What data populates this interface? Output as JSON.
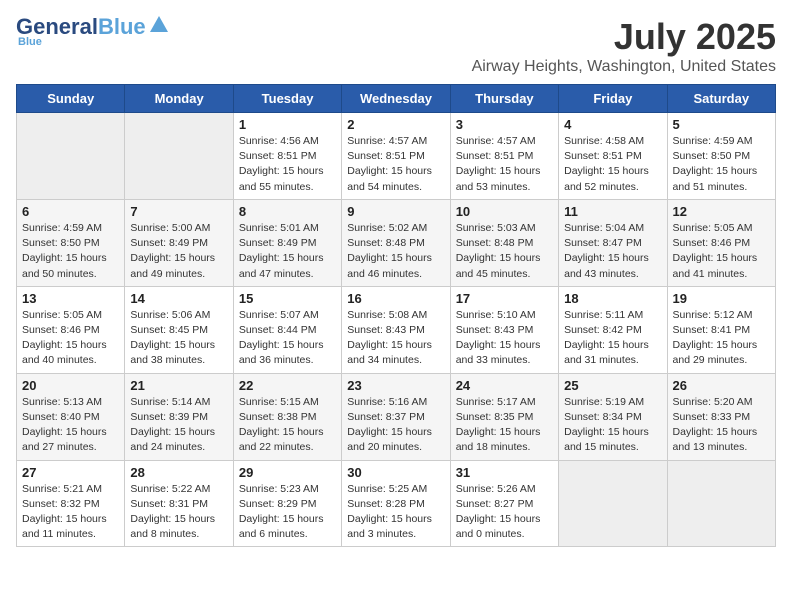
{
  "header": {
    "logo_line1": "General",
    "logo_line2": "Blue",
    "month": "July 2025",
    "location": "Airway Heights, Washington, United States"
  },
  "weekdays": [
    "Sunday",
    "Monday",
    "Tuesday",
    "Wednesday",
    "Thursday",
    "Friday",
    "Saturday"
  ],
  "weeks": [
    [
      {
        "day": "",
        "sunrise": "",
        "sunset": "",
        "daylight": "",
        "empty": true
      },
      {
        "day": "",
        "sunrise": "",
        "sunset": "",
        "daylight": "",
        "empty": true
      },
      {
        "day": "1",
        "sunrise": "Sunrise: 4:56 AM",
        "sunset": "Sunset: 8:51 PM",
        "daylight": "Daylight: 15 hours and 55 minutes."
      },
      {
        "day": "2",
        "sunrise": "Sunrise: 4:57 AM",
        "sunset": "Sunset: 8:51 PM",
        "daylight": "Daylight: 15 hours and 54 minutes."
      },
      {
        "day": "3",
        "sunrise": "Sunrise: 4:57 AM",
        "sunset": "Sunset: 8:51 PM",
        "daylight": "Daylight: 15 hours and 53 minutes."
      },
      {
        "day": "4",
        "sunrise": "Sunrise: 4:58 AM",
        "sunset": "Sunset: 8:51 PM",
        "daylight": "Daylight: 15 hours and 52 minutes."
      },
      {
        "day": "5",
        "sunrise": "Sunrise: 4:59 AM",
        "sunset": "Sunset: 8:50 PM",
        "daylight": "Daylight: 15 hours and 51 minutes."
      }
    ],
    [
      {
        "day": "6",
        "sunrise": "Sunrise: 4:59 AM",
        "sunset": "Sunset: 8:50 PM",
        "daylight": "Daylight: 15 hours and 50 minutes."
      },
      {
        "day": "7",
        "sunrise": "Sunrise: 5:00 AM",
        "sunset": "Sunset: 8:49 PM",
        "daylight": "Daylight: 15 hours and 49 minutes."
      },
      {
        "day": "8",
        "sunrise": "Sunrise: 5:01 AM",
        "sunset": "Sunset: 8:49 PM",
        "daylight": "Daylight: 15 hours and 47 minutes."
      },
      {
        "day": "9",
        "sunrise": "Sunrise: 5:02 AM",
        "sunset": "Sunset: 8:48 PM",
        "daylight": "Daylight: 15 hours and 46 minutes."
      },
      {
        "day": "10",
        "sunrise": "Sunrise: 5:03 AM",
        "sunset": "Sunset: 8:48 PM",
        "daylight": "Daylight: 15 hours and 45 minutes."
      },
      {
        "day": "11",
        "sunrise": "Sunrise: 5:04 AM",
        "sunset": "Sunset: 8:47 PM",
        "daylight": "Daylight: 15 hours and 43 minutes."
      },
      {
        "day": "12",
        "sunrise": "Sunrise: 5:05 AM",
        "sunset": "Sunset: 8:46 PM",
        "daylight": "Daylight: 15 hours and 41 minutes."
      }
    ],
    [
      {
        "day": "13",
        "sunrise": "Sunrise: 5:05 AM",
        "sunset": "Sunset: 8:46 PM",
        "daylight": "Daylight: 15 hours and 40 minutes."
      },
      {
        "day": "14",
        "sunrise": "Sunrise: 5:06 AM",
        "sunset": "Sunset: 8:45 PM",
        "daylight": "Daylight: 15 hours and 38 minutes."
      },
      {
        "day": "15",
        "sunrise": "Sunrise: 5:07 AM",
        "sunset": "Sunset: 8:44 PM",
        "daylight": "Daylight: 15 hours and 36 minutes."
      },
      {
        "day": "16",
        "sunrise": "Sunrise: 5:08 AM",
        "sunset": "Sunset: 8:43 PM",
        "daylight": "Daylight: 15 hours and 34 minutes."
      },
      {
        "day": "17",
        "sunrise": "Sunrise: 5:10 AM",
        "sunset": "Sunset: 8:43 PM",
        "daylight": "Daylight: 15 hours and 33 minutes."
      },
      {
        "day": "18",
        "sunrise": "Sunrise: 5:11 AM",
        "sunset": "Sunset: 8:42 PM",
        "daylight": "Daylight: 15 hours and 31 minutes."
      },
      {
        "day": "19",
        "sunrise": "Sunrise: 5:12 AM",
        "sunset": "Sunset: 8:41 PM",
        "daylight": "Daylight: 15 hours and 29 minutes."
      }
    ],
    [
      {
        "day": "20",
        "sunrise": "Sunrise: 5:13 AM",
        "sunset": "Sunset: 8:40 PM",
        "daylight": "Daylight: 15 hours and 27 minutes."
      },
      {
        "day": "21",
        "sunrise": "Sunrise: 5:14 AM",
        "sunset": "Sunset: 8:39 PM",
        "daylight": "Daylight: 15 hours and 24 minutes."
      },
      {
        "day": "22",
        "sunrise": "Sunrise: 5:15 AM",
        "sunset": "Sunset: 8:38 PM",
        "daylight": "Daylight: 15 hours and 22 minutes."
      },
      {
        "day": "23",
        "sunrise": "Sunrise: 5:16 AM",
        "sunset": "Sunset: 8:37 PM",
        "daylight": "Daylight: 15 hours and 20 minutes."
      },
      {
        "day": "24",
        "sunrise": "Sunrise: 5:17 AM",
        "sunset": "Sunset: 8:35 PM",
        "daylight": "Daylight: 15 hours and 18 minutes."
      },
      {
        "day": "25",
        "sunrise": "Sunrise: 5:19 AM",
        "sunset": "Sunset: 8:34 PM",
        "daylight": "Daylight: 15 hours and 15 minutes."
      },
      {
        "day": "26",
        "sunrise": "Sunrise: 5:20 AM",
        "sunset": "Sunset: 8:33 PM",
        "daylight": "Daylight: 15 hours and 13 minutes."
      }
    ],
    [
      {
        "day": "27",
        "sunrise": "Sunrise: 5:21 AM",
        "sunset": "Sunset: 8:32 PM",
        "daylight": "Daylight: 15 hours and 11 minutes."
      },
      {
        "day": "28",
        "sunrise": "Sunrise: 5:22 AM",
        "sunset": "Sunset: 8:31 PM",
        "daylight": "Daylight: 15 hours and 8 minutes."
      },
      {
        "day": "29",
        "sunrise": "Sunrise: 5:23 AM",
        "sunset": "Sunset: 8:29 PM",
        "daylight": "Daylight: 15 hours and 6 minutes."
      },
      {
        "day": "30",
        "sunrise": "Sunrise: 5:25 AM",
        "sunset": "Sunset: 8:28 PM",
        "daylight": "Daylight: 15 hours and 3 minutes."
      },
      {
        "day": "31",
        "sunrise": "Sunrise: 5:26 AM",
        "sunset": "Sunset: 8:27 PM",
        "daylight": "Daylight: 15 hours and 0 minutes."
      },
      {
        "day": "",
        "sunrise": "",
        "sunset": "",
        "daylight": "",
        "empty": true
      },
      {
        "day": "",
        "sunrise": "",
        "sunset": "",
        "daylight": "",
        "empty": true
      }
    ]
  ]
}
